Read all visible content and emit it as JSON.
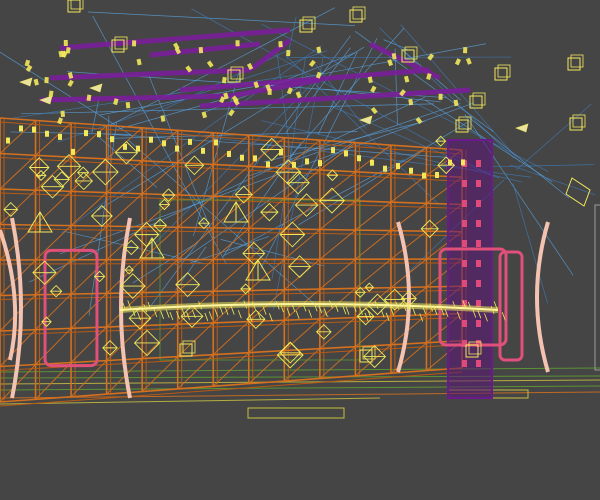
{
  "viewport": {
    "background": "#454545",
    "view": "perspective",
    "render_mode": "wireframe"
  },
  "colors": {
    "truss": "#d4701e",
    "truss_dark": "#b85a14",
    "light_fixture": "#f2e85a",
    "light_beam": "#5aa8e8",
    "light_beam_alt": "#3f7fc0",
    "overhead_rig": "#7a1f9a",
    "column": "#6a1a8a",
    "arch_frame": "#f4c2b0",
    "arch_panel": "#e0507a",
    "floor_green": "#5fa030",
    "floor_yellow": "#c8c040",
    "floor_orange": "#d4701e"
  },
  "scene": {
    "objects": [
      {
        "kind": "truss-grid",
        "name": "main-truss-wall"
      },
      {
        "kind": "overhead-rig",
        "name": "overhead-light-rig"
      },
      {
        "kind": "column",
        "name": "purple-led-column"
      },
      {
        "kind": "arch-frame",
        "name": "arch-frame-left"
      },
      {
        "kind": "arch-frame",
        "name": "arch-frame-right"
      },
      {
        "kind": "light-strip",
        "name": "center-light-strip"
      },
      {
        "kind": "floor",
        "name": "stage-floor-lines"
      }
    ]
  }
}
